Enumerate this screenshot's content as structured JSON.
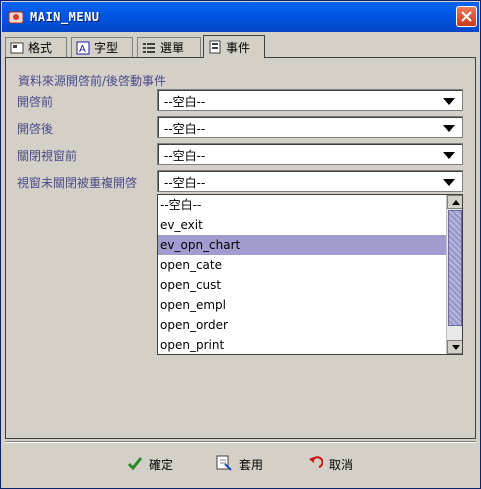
{
  "window": {
    "title": "MAIN_MENU"
  },
  "tabs": [
    {
      "label": "格式",
      "active": false
    },
    {
      "label": "字型",
      "active": false
    },
    {
      "label": "選單",
      "active": false
    },
    {
      "label": "事件",
      "active": true
    }
  ],
  "section_label": "資料來源開啓前/後啓動事件",
  "fields": [
    {
      "label": "開啓前",
      "value": "--空白--"
    },
    {
      "label": "開啓後",
      "value": "--空白--"
    },
    {
      "label": "關閉視窗前",
      "value": "--空白--"
    },
    {
      "label": "視窗未關閉被重複開啓",
      "value": "--空白--"
    }
  ],
  "dropdown": {
    "options": [
      "--空白--",
      "ev_exit",
      "ev_opn_chart",
      "open_cate",
      "open_cust",
      "open_empl",
      "open_order",
      "open_print"
    ],
    "selected": "ev_opn_chart"
  },
  "buttons": {
    "ok": "確定",
    "apply": "套用",
    "cancel": "取消"
  },
  "colors": {
    "selection": "#a09cd0",
    "label_text": "#4a4a8a",
    "titlebar": "#0058e6"
  }
}
